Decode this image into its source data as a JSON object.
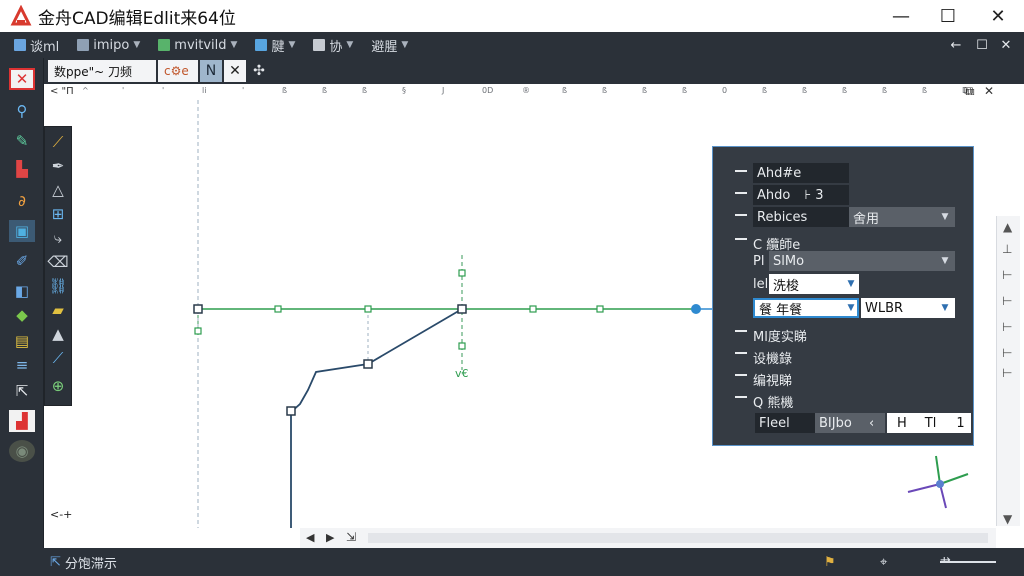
{
  "app": {
    "title": "金舟CAD编辑Edlit来64位",
    "window_controls": {
      "minimize": "—",
      "maximize": "☐",
      "close": "✕"
    }
  },
  "menubar": {
    "items": [
      {
        "label": "谈ml"
      },
      {
        "label": "imipo"
      },
      {
        "label": "mvitvild"
      },
      {
        "label": "腱"
      },
      {
        "label": "协"
      },
      {
        "label": "避腥"
      }
    ],
    "mdi_controls": {
      "back": "←",
      "restore": "☐",
      "close": "✕"
    }
  },
  "doc_tabs": {
    "tab1": "数ppe\"~ 刀频",
    "tab2": "c⚙e",
    "n_btn": "N",
    "x_btn": "✕",
    "extra": "✣"
  },
  "ruler": {
    "left_label": "< \"П",
    "ticks": [
      "^",
      "'",
      "'",
      "li",
      "'",
      "ß",
      "ß",
      "ß",
      "§",
      "J",
      "0D",
      "®",
      "ß",
      "ß",
      "ß",
      "ß",
      "0",
      "ß",
      "ß",
      "ß",
      "ß",
      "ß",
      "D"
    ],
    "right_icons": [
      "⧉",
      "✕"
    ]
  },
  "canvas": {
    "marker_bottom_left": "<-+",
    "marker_green": "v€"
  },
  "properties": {
    "rows": [
      {
        "label": "Ahd#e",
        "value": ""
      },
      {
        "label": "Ahdo",
        "value": "⊦ 3"
      },
      {
        "label": "Rebices",
        "value": "",
        "select": "舍用"
      },
      {
        "label": "C 纜師e",
        "value": ""
      },
      {
        "prefix": "Pl",
        "value": "SlMo"
      },
      {
        "prefix": "lel",
        "value": "洗梭"
      },
      {
        "value": "餐 年餐",
        "value2": "WLBR"
      },
      {
        "label": "Ml度实睇",
        "value": ""
      },
      {
        "label": "设機錄",
        "value": ""
      },
      {
        "label": "编視睇",
        "value": ""
      },
      {
        "label": "Q 熊機",
        "value": ""
      }
    ],
    "footer": {
      "field1": "Fleel",
      "field2": "BIJbo",
      "field3": "‹",
      "field4": "H",
      "field5": "Tl",
      "field6": "1"
    }
  },
  "scrollbar": {
    "left": "◀",
    "right": "▶",
    "extra": "⇲"
  },
  "statusbar": {
    "text": "分饱滞示",
    "right_icons": [
      "⚑",
      "⌖",
      "⇸"
    ]
  },
  "colors": {
    "green_line": "#2e9d4f",
    "dark_line": "#2a4a6a",
    "guide": "#9aa9b8",
    "accent": "#2f8ad0"
  }
}
